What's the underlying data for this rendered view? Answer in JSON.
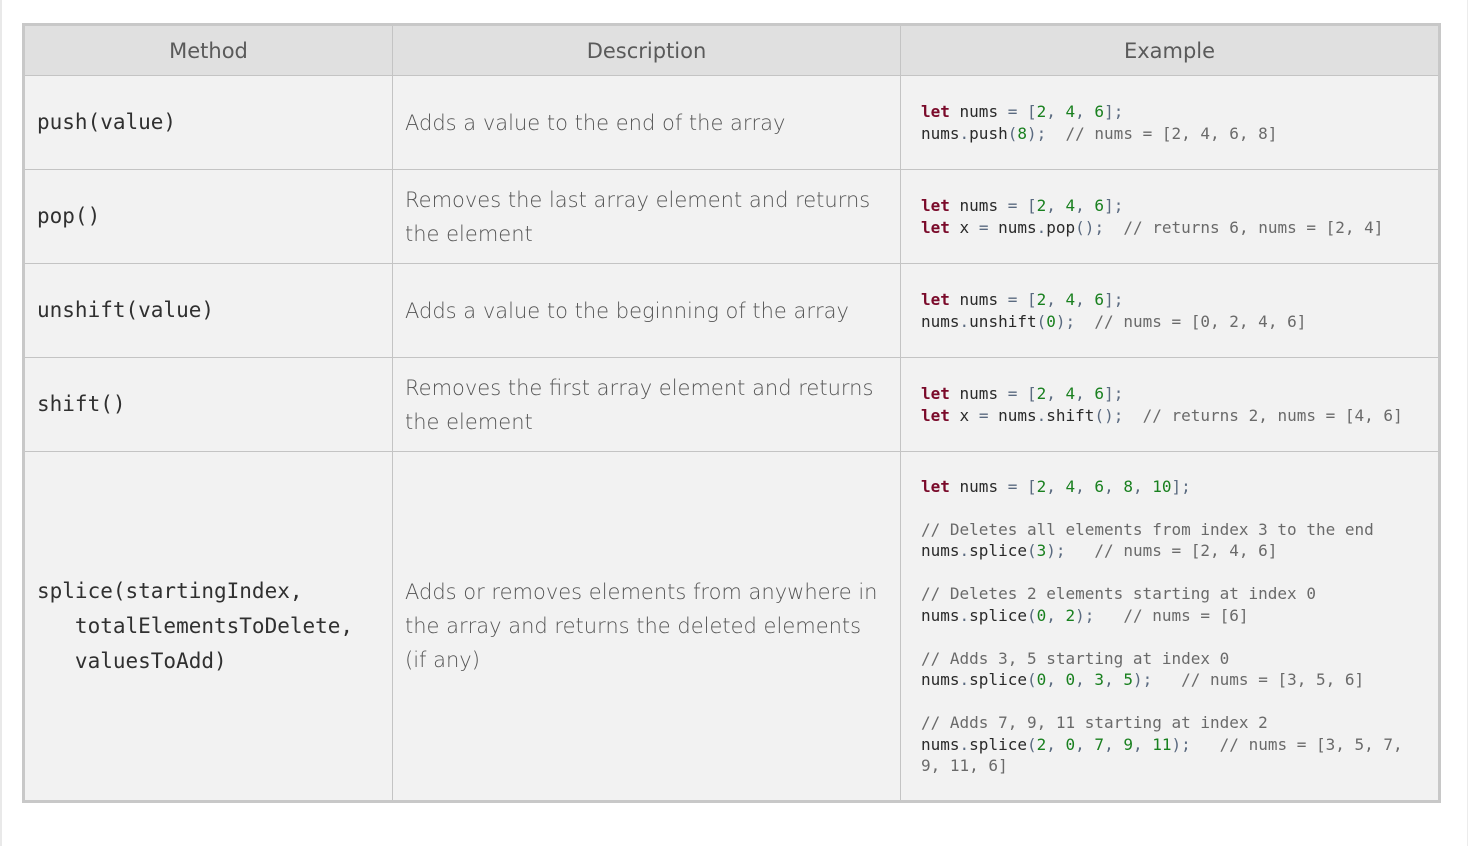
{
  "table": {
    "headers": [
      "Method",
      "Description",
      "Example"
    ],
    "rows": [
      {
        "method": "push(value)",
        "description": "Adds a value to the end of the array",
        "example": [
          [
            [
              "let",
              "kw"
            ],
            [
              " nums ",
              ""
            ],
            [
              "=",
              "pun"
            ],
            [
              " [",
              "pun"
            ],
            [
              "2",
              "num"
            ],
            [
              ", ",
              "pun"
            ],
            [
              "4",
              "num"
            ],
            [
              ", ",
              "pun"
            ],
            [
              "6",
              "num"
            ],
            [
              "];",
              "pun"
            ]
          ],
          [
            [
              "nums",
              ""
            ],
            [
              ".",
              "pun"
            ],
            [
              "push",
              ""
            ],
            [
              "(",
              "pun"
            ],
            [
              "8",
              "num"
            ],
            [
              ");",
              "pun"
            ],
            [
              "  // nums = [2, 4, 6, 8]",
              "cm"
            ]
          ]
        ]
      },
      {
        "method": "pop()",
        "description": "Removes the last array element and returns the element",
        "example": [
          [
            [
              "let",
              "kw"
            ],
            [
              " nums ",
              ""
            ],
            [
              "=",
              "pun"
            ],
            [
              " [",
              "pun"
            ],
            [
              "2",
              "num"
            ],
            [
              ", ",
              "pun"
            ],
            [
              "4",
              "num"
            ],
            [
              ", ",
              "pun"
            ],
            [
              "6",
              "num"
            ],
            [
              "];",
              "pun"
            ]
          ],
          [
            [
              "let",
              "kw"
            ],
            [
              " x ",
              ""
            ],
            [
              "=",
              "pun"
            ],
            [
              " nums",
              ""
            ],
            [
              ".",
              "pun"
            ],
            [
              "pop",
              ""
            ],
            [
              "();",
              "pun"
            ],
            [
              "  // returns 6, nums = [2, 4]",
              "cm"
            ]
          ]
        ]
      },
      {
        "method": "unshift(value)",
        "description": "Adds a value to the beginning of the array",
        "example": [
          [
            [
              "let",
              "kw"
            ],
            [
              " nums ",
              ""
            ],
            [
              "=",
              "pun"
            ],
            [
              " [",
              "pun"
            ],
            [
              "2",
              "num"
            ],
            [
              ", ",
              "pun"
            ],
            [
              "4",
              "num"
            ],
            [
              ", ",
              "pun"
            ],
            [
              "6",
              "num"
            ],
            [
              "];",
              "pun"
            ]
          ],
          [
            [
              "nums",
              ""
            ],
            [
              ".",
              "pun"
            ],
            [
              "unshift",
              ""
            ],
            [
              "(",
              "pun"
            ],
            [
              "0",
              "num"
            ],
            [
              ");",
              "pun"
            ],
            [
              "  // nums = [0, 2, 4, 6]",
              "cm"
            ]
          ]
        ]
      },
      {
        "method": "shift()",
        "description": "Removes the first array element and returns the element",
        "example": [
          [
            [
              "let",
              "kw"
            ],
            [
              " nums ",
              ""
            ],
            [
              "=",
              "pun"
            ],
            [
              " [",
              "pun"
            ],
            [
              "2",
              "num"
            ],
            [
              ", ",
              "pun"
            ],
            [
              "4",
              "num"
            ],
            [
              ", ",
              "pun"
            ],
            [
              "6",
              "num"
            ],
            [
              "];",
              "pun"
            ]
          ],
          [
            [
              "let",
              "kw"
            ],
            [
              " x ",
              ""
            ],
            [
              "=",
              "pun"
            ],
            [
              " nums",
              ""
            ],
            [
              ".",
              "pun"
            ],
            [
              "shift",
              ""
            ],
            [
              "();",
              "pun"
            ],
            [
              "  // returns 2, nums = [4, 6]",
              "cm"
            ]
          ]
        ]
      },
      {
        "method": "splice(startingIndex,\n   totalElementsToDelete,\n   valuesToAdd)",
        "description": "Adds or removes elements from anywhere in the array and returns the deleted elements (if any)",
        "example": [
          [
            [
              "let",
              "kw"
            ],
            [
              " nums ",
              ""
            ],
            [
              "=",
              "pun"
            ],
            [
              " [",
              "pun"
            ],
            [
              "2",
              "num"
            ],
            [
              ", ",
              "pun"
            ],
            [
              "4",
              "num"
            ],
            [
              ", ",
              "pun"
            ],
            [
              "6",
              "num"
            ],
            [
              ", ",
              "pun"
            ],
            [
              "8",
              "num"
            ],
            [
              ", ",
              "pun"
            ],
            [
              "10",
              "num"
            ],
            [
              "];",
              "pun"
            ]
          ],
          [],
          [
            [
              "// Deletes all elements from index 3 to the end",
              "cm"
            ]
          ],
          [
            [
              "nums",
              ""
            ],
            [
              ".",
              "pun"
            ],
            [
              "splice",
              ""
            ],
            [
              "(",
              "pun"
            ],
            [
              "3",
              "num"
            ],
            [
              ");",
              "pun"
            ],
            [
              "   // nums = [2, 4, 6]",
              "cm"
            ]
          ],
          [],
          [
            [
              "// Deletes 2 elements starting at index 0",
              "cm"
            ]
          ],
          [
            [
              "nums",
              ""
            ],
            [
              ".",
              "pun"
            ],
            [
              "splice",
              ""
            ],
            [
              "(",
              "pun"
            ],
            [
              "0",
              "num"
            ],
            [
              ", ",
              "pun"
            ],
            [
              "2",
              "num"
            ],
            [
              ");",
              "pun"
            ],
            [
              "   // nums = [6]",
              "cm"
            ]
          ],
          [],
          [
            [
              "// Adds 3, 5 starting at index 0",
              "cm"
            ]
          ],
          [
            [
              "nums",
              ""
            ],
            [
              ".",
              "pun"
            ],
            [
              "splice",
              ""
            ],
            [
              "(",
              "pun"
            ],
            [
              "0",
              "num"
            ],
            [
              ", ",
              "pun"
            ],
            [
              "0",
              "num"
            ],
            [
              ", ",
              "pun"
            ],
            [
              "3",
              "num"
            ],
            [
              ", ",
              "pun"
            ],
            [
              "5",
              "num"
            ],
            [
              ");",
              "pun"
            ],
            [
              "   // nums = [3, 5, 6]",
              "cm"
            ]
          ],
          [],
          [
            [
              "// Adds 7, 9, 11 starting at index 2",
              "cm"
            ]
          ],
          [
            [
              "nums",
              ""
            ],
            [
              ".",
              "pun"
            ],
            [
              "splice",
              ""
            ],
            [
              "(",
              "pun"
            ],
            [
              "2",
              "num"
            ],
            [
              ", ",
              "pun"
            ],
            [
              "0",
              "num"
            ],
            [
              ", ",
              "pun"
            ],
            [
              "7",
              "num"
            ],
            [
              ", ",
              "pun"
            ],
            [
              "9",
              "num"
            ],
            [
              ", ",
              "pun"
            ],
            [
              "11",
              "num"
            ],
            [
              ");",
              "pun"
            ],
            [
              "   // nums = [3, 5, 7,",
              "cm"
            ]
          ],
          [
            [
              "9, 11, 6]",
              "cm"
            ]
          ]
        ]
      }
    ]
  }
}
